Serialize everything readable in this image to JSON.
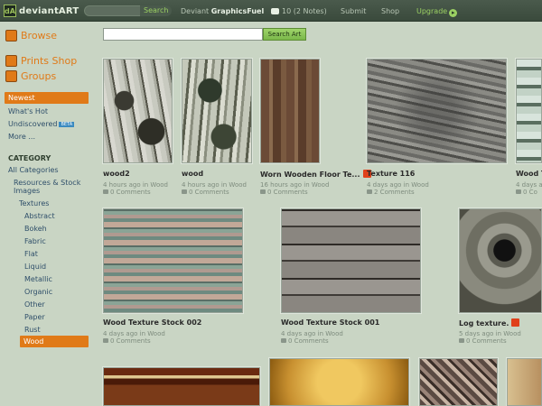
{
  "topbar": {
    "logo_mark": "dA",
    "logo_text": "deviantART",
    "search_button": "Search",
    "user_prefix": "Deviant",
    "username": "GraphicsFuel",
    "notes": "10 (2 Notes)",
    "submit": "Submit",
    "shop": "Shop",
    "upgrade": "Upgrade"
  },
  "sidebar": {
    "browse": "Browse",
    "prints_shop": "Prints Shop",
    "groups": "Groups",
    "sort": [
      "Newest",
      "What's Hot",
      "Undiscovered",
      "More ..."
    ],
    "beta": "BETA",
    "category_title": "CATEGORY",
    "all_categories": "All Categories",
    "resources_line1": "Resources & Stock",
    "resources_line2": "Images",
    "textures": "Textures",
    "subcats": [
      "Abstract",
      "Bokeh",
      "Fabric",
      "Flat",
      "Liquid",
      "Metallic",
      "Organic",
      "Other",
      "Paper",
      "Rust",
      "Wood"
    ]
  },
  "main": {
    "search_placeholder": "",
    "search_button": "Search Art",
    "row1": [
      {
        "title": "wood2",
        "meta": "4 hours ago in Wood",
        "comments": "0 Comments"
      },
      {
        "title": "wood",
        "meta": "4 hours ago in Wood",
        "comments": "0 Comments"
      },
      {
        "title": "Worn Wooden Floor Te...",
        "meta": "16 hours ago in Wood",
        "comments": "0 Comments"
      },
      {
        "title": "Texture 116",
        "meta": "4 days ago in Wood",
        "comments": "2 Comments"
      },
      {
        "title": "Wood T",
        "meta": "4 days a",
        "comments": "0 Co"
      }
    ],
    "row2": [
      {
        "title": "Wood Texture Stock 002",
        "meta": "4 days ago in Wood",
        "comments": "0 Comments"
      },
      {
        "title": "Wood Texture Stock 001",
        "meta": "4 days ago in Wood",
        "comments": "0 Comments"
      },
      {
        "title": "Log texture.",
        "meta": "5 days ago in Wood",
        "comments": "0 Comments"
      }
    ]
  },
  "colors": {
    "accent": "#e07a18",
    "bg": "#c9d5c4",
    "topbar": "#3f4f41",
    "green": "#9bd063"
  }
}
